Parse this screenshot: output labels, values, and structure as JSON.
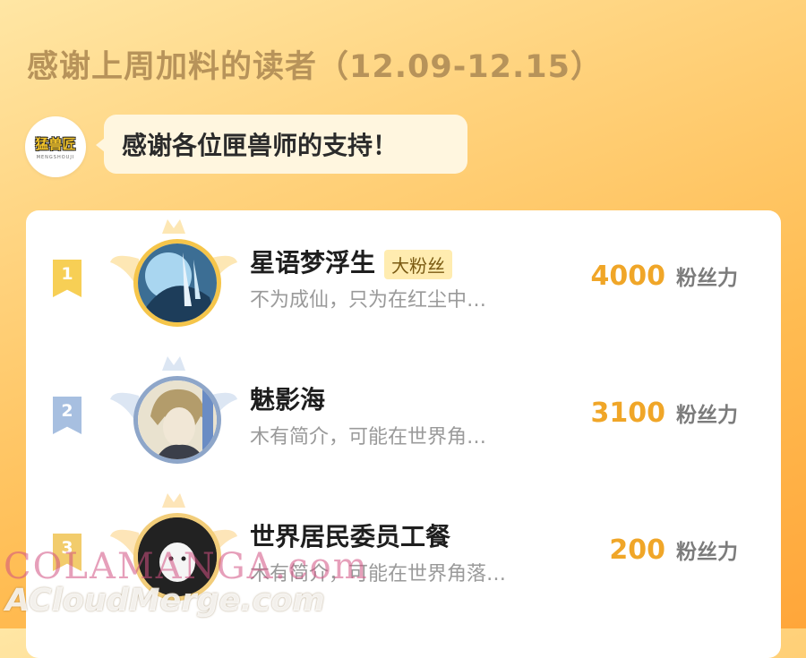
{
  "header": {
    "title": "感谢上周加料的读者（12.09-12.15）"
  },
  "logo": {
    "text": "猛兽匠",
    "subtext": "MENGSHOUJI"
  },
  "bubble": {
    "text": "感谢各位匣兽师的支持！"
  },
  "rows": [
    {
      "rank": "1",
      "name": "星语梦浮生",
      "badge": "大粉丝",
      "bio": "不为成仙，只为在红尘中…",
      "score": "4000",
      "unit": "粉丝力"
    },
    {
      "rank": "2",
      "name": "魅影海",
      "bio": "木有简介，可能在世界角…",
      "score": "3100",
      "unit": "粉丝力"
    },
    {
      "rank": "3",
      "name": "世界居民委员工餐",
      "bio": "木有简介，可能在世界角落…",
      "score": "200",
      "unit": "粉丝力"
    }
  ],
  "watermark": {
    "line1": "COLAMANGA.com",
    "line2": "ACloudMerge.com"
  }
}
